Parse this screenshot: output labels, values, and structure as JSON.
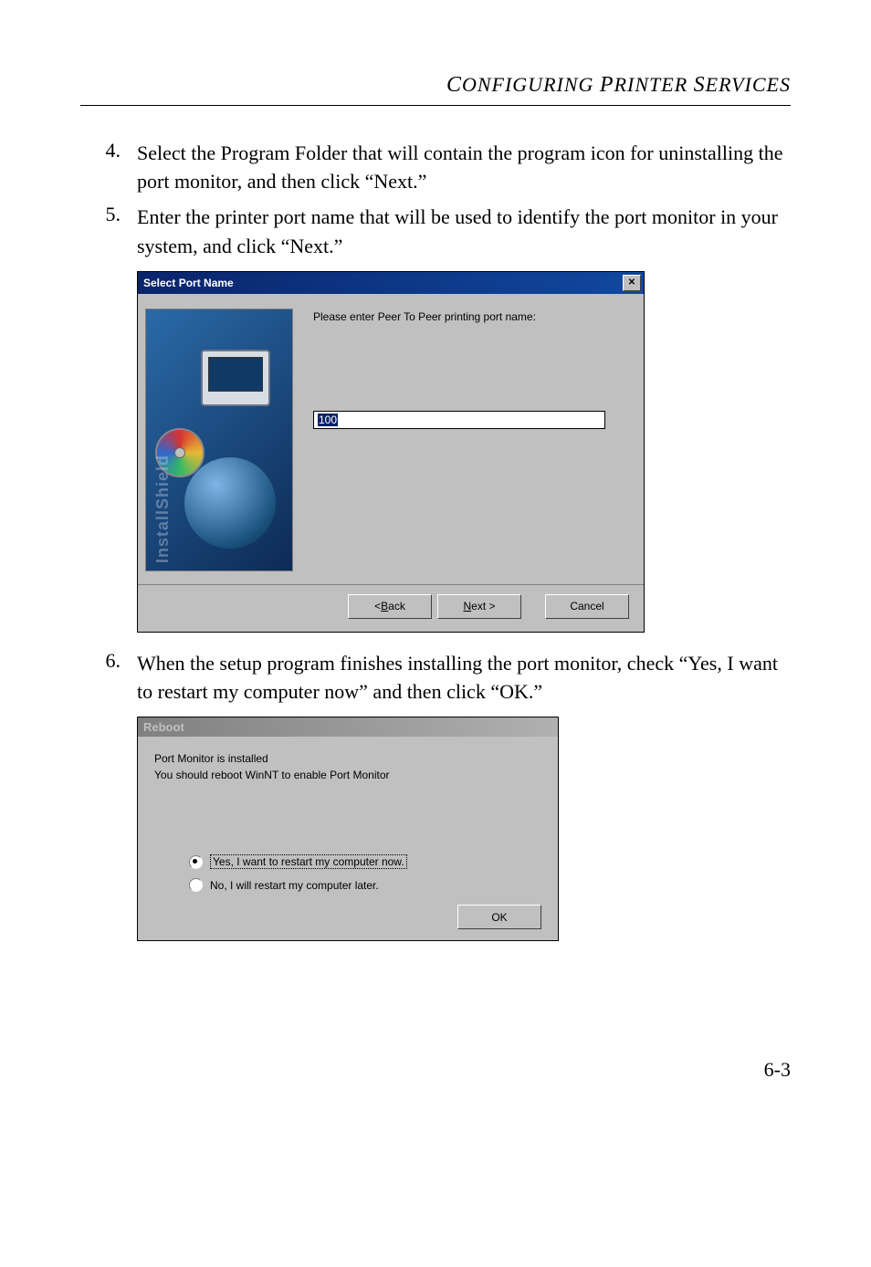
{
  "header": "Configuring Printer Services",
  "steps": [
    {
      "num": "4.",
      "text": "Select the Program Folder that will contain the program icon for uninstalling the port monitor, and then click “Next.”"
    },
    {
      "num": "5.",
      "text": "Enter the printer port name that will be used to identify the port monitor in your system, and click “Next.”"
    },
    {
      "num": "6.",
      "text": "When the setup program finishes installing the port monitor, check “Yes, I want to restart my computer now” and then click “OK.”"
    }
  ],
  "selectPortName": {
    "title": "Select Port Name",
    "prompt": "Please enter Peer To Peer printing port name:",
    "inputValue": "100",
    "buttons": {
      "back_prefix": "< ",
      "back_u": "B",
      "back_suffix": "ack",
      "next_u": "N",
      "next_suffix": "ext >",
      "cancel": "Cancel"
    }
  },
  "reboot": {
    "title": "Reboot",
    "line1": "Port Monitor is installed",
    "line2": "You should reboot WinNT to enable Port Monitor",
    "optionYes": "Yes, I want to restart my computer now.",
    "optionNo": "No, I will restart my computer later.",
    "ok": "OK"
  },
  "installShield": "InstallShield",
  "pageNumber": "6-3"
}
